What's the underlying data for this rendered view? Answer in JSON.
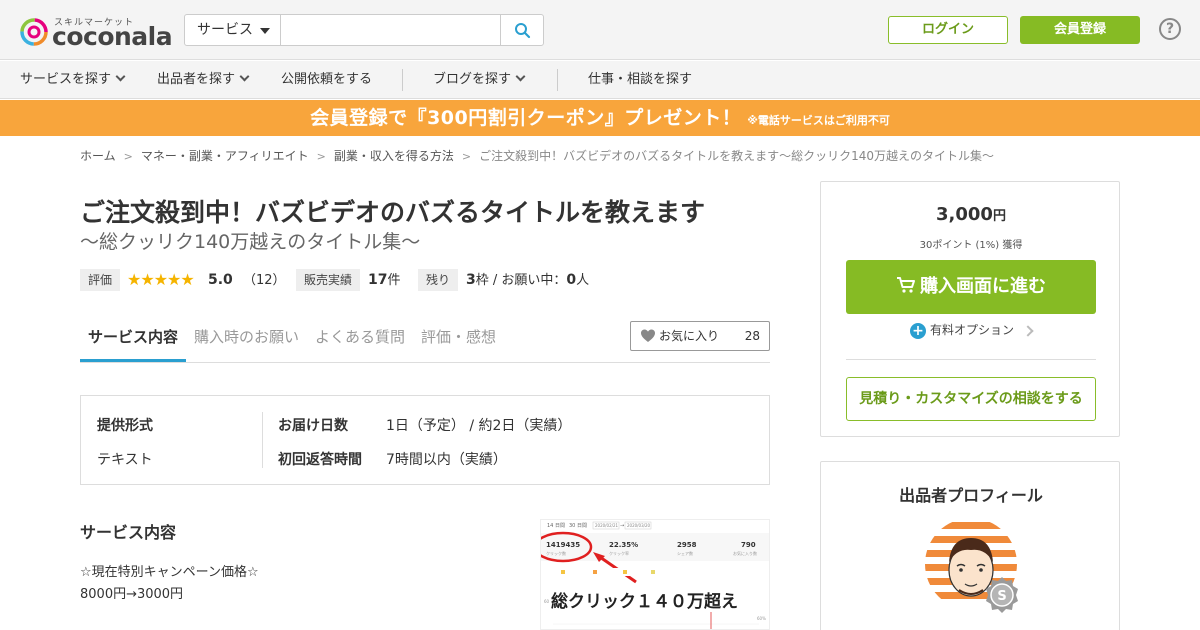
{
  "header": {
    "logo_sub": "スキルマーケット",
    "logo_text": "coconala",
    "search_category": "サービス",
    "search_value": "",
    "login_label": "ログイン",
    "register_label": "会員登録",
    "help_label": "?"
  },
  "nav": {
    "items": [
      {
        "label": "サービスを探す"
      },
      {
        "label": "出品者を探す"
      },
      {
        "label": "公開依頼をする"
      },
      {
        "label": "ブログを探す"
      },
      {
        "label": "仕事・相談を探す"
      }
    ]
  },
  "banner": {
    "main": "会員登録で『300円割引クーポン』プレゼント！",
    "note": "※電話サービスはご利用不可"
  },
  "breadcrumb": [
    "ホーム",
    "マネー・副業・アフィリエイト",
    "副業・収入を得る方法",
    "ご注文殺到中！バズビデオのバズるタイトルを教えます〜総クッリク140万越えのタイトル集〜"
  ],
  "breadcrumb_sep": ">",
  "service": {
    "title": "ご注文殺到中！バズビデオのバズるタイトルを教えます",
    "subtitle": "〜総クッリク140万越えのタイトル集〜",
    "rating_label": "評価",
    "rating": "5.0",
    "rating_stars": 5,
    "rating_stars_text": "★★★★★",
    "review_count": "（12）",
    "sales_label": "販売実績",
    "sales_value": "17",
    "sales_unit": "件",
    "remaining_label": "残り",
    "remaining_value": "3",
    "remaining_unit": "枠 / お願い中：",
    "requesting_value": "0",
    "requesting_unit": "人"
  },
  "tabs": [
    {
      "label": "サービス内容",
      "active": true
    },
    {
      "label": "購入時のお願い",
      "active": false
    },
    {
      "label": "よくある質問",
      "active": false
    },
    {
      "label": "評価・感想",
      "active": false
    }
  ],
  "favorite": {
    "label": "お気に入り",
    "count": "28"
  },
  "spec": {
    "format_label": "提供形式",
    "format_value": "テキスト",
    "delivery_label": "お届け日数",
    "delivery_value": "1日（予定） / 約2日（実績）",
    "reply_label": "初回返答時間",
    "reply_value": "7時間以内（実績）"
  },
  "description": {
    "heading": "サービス内容",
    "line1": "☆現在特別キャンペーン価格☆",
    "line2": "8000円→3000円"
  },
  "screenshot": {
    "tab1": "14 日間",
    "tab2": "30 日間",
    "date1": "2020/02/21",
    "date2": "2020/03/20",
    "stat1_value": "1419435",
    "stat1_label": "クリック数",
    "stat2_value": "22.35%",
    "stat2_label": "クリック率",
    "stat3_value": "2958",
    "stat3_label": "シェア数",
    "stat4_value": "790",
    "stat4_label": "お気に入り数",
    "axis_top": "60",
    "axis_pct": "60%",
    "caption": "総クリック１４０万超え"
  },
  "purchase": {
    "price": "3,000",
    "price_unit": "円",
    "points": "30ポイント (1%) 獲得",
    "buy_label": "購入画面に進む",
    "option_label": "有料オプション",
    "quote_label": "見積り・カスタマイズの相談をする"
  },
  "profile": {
    "heading": "出品者プロフィール",
    "badge_letter": "S"
  },
  "colors": {
    "green": "#86bb24",
    "orange": "#f8a53c",
    "blue": "#2a9fd0"
  }
}
